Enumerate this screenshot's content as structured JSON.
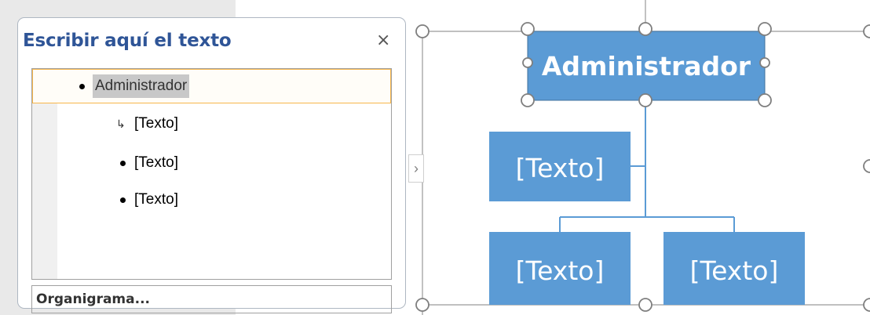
{
  "text_pane": {
    "title": "Escribir aquí el texto",
    "close_glyph": "×",
    "items": [
      {
        "text": "Administrador",
        "level": 1,
        "selected": true
      },
      {
        "text": "[Texto]",
        "level": 2
      },
      {
        "text": "[Texto]",
        "level": 1
      },
      {
        "text": "[Texto]",
        "level": 1
      }
    ],
    "footer_label": "Organigrama...",
    "expander_glyph": "›"
  },
  "diagram": {
    "box_color": "#5b9bd5",
    "line_color": "#5b9bd5",
    "nodes": [
      {
        "role": "top",
        "text": "Administrador"
      },
      {
        "role": "assistant",
        "text": "[Texto]"
      },
      {
        "role": "child-left",
        "text": "[Texto]"
      },
      {
        "role": "child-right",
        "text": "[Texto]"
      }
    ]
  }
}
